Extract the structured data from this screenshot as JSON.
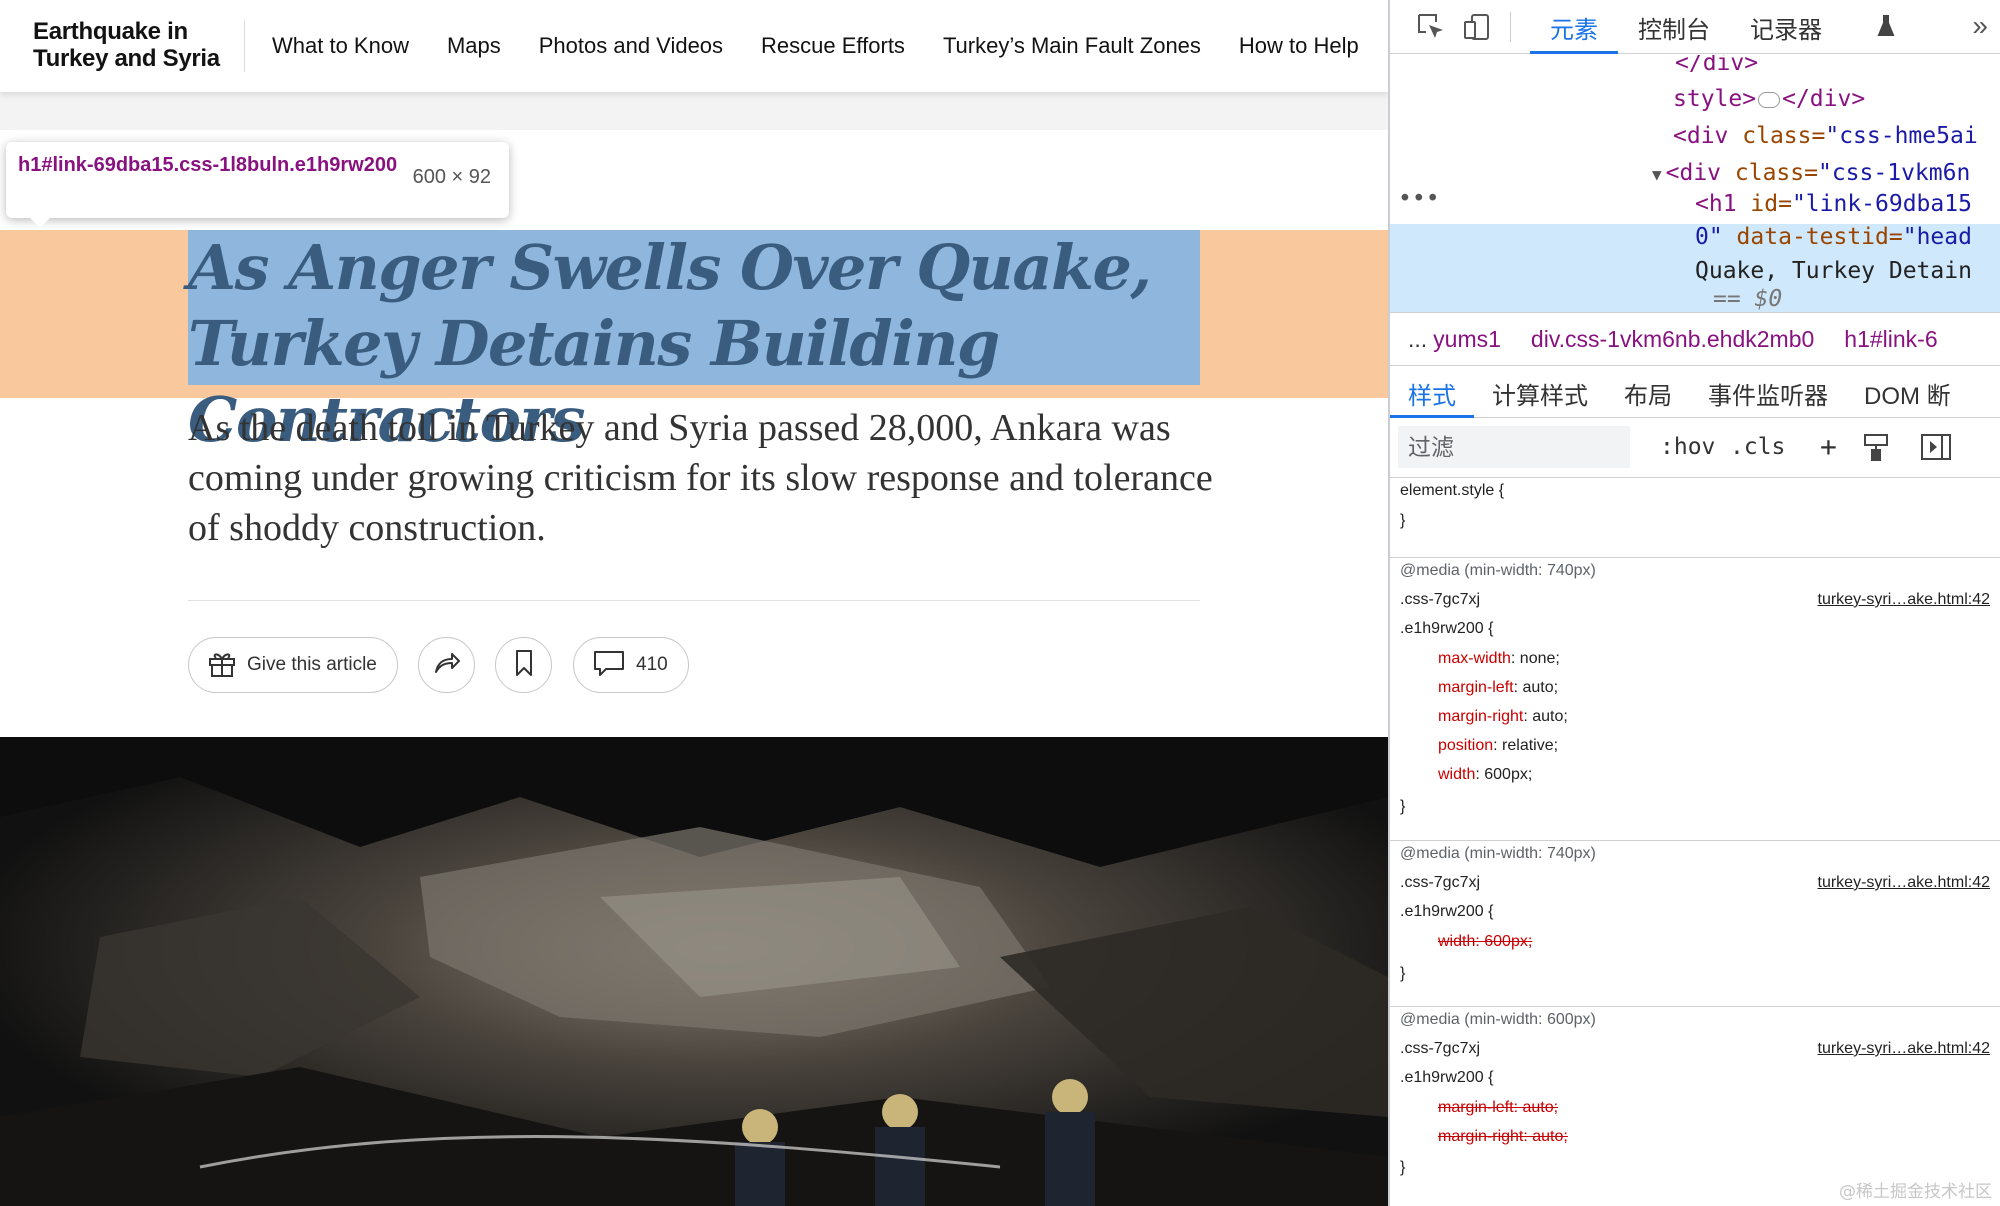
{
  "site": {
    "title_line1": "Earthquake in",
    "title_line2": "Turkey and Syria",
    "nav": [
      "What to Know",
      "Maps",
      "Photos and Videos",
      "Rescue Efforts",
      "Turkey’s Main Fault Zones",
      "How to Help"
    ]
  },
  "inspector_tooltip": {
    "selector": "h1#link-69dba15.css-1l8buln.e1h9rw200",
    "size": "600 × 92"
  },
  "article": {
    "headline": "As Anger Swells Over Quake, Turkey Detains Building Contractors",
    "summary": "As the death toll in Turkey and Syria passed 28,000, Ankara was coming under growing criticism for its slow response and tolerance of shoddy construction.",
    "gift_label": "Give this article",
    "comment_count": "410"
  },
  "devtools": {
    "tabs": [
      "元素",
      "控制台",
      "记录器"
    ],
    "dom": {
      "line0": "style>",
      "line0_end": "</div>",
      "line1_tag": "<div ",
      "line1_attr": "class=",
      "line1_val": "\"css-hme5ai",
      "line2_tag": "<div ",
      "line2_attr": "class=",
      "line2_val": "\"css-1vkm6n",
      "line3_tag": "<h1 ",
      "line3_attr": "id=",
      "line3_val": "\"link-69dba15",
      "line4_val": "0\"",
      "line4_attr": " data-testid=",
      "line4_val2": "\"head",
      "line5": "Quake, Turkey Detain",
      "line6": "== $0"
    },
    "breadcrumb": [
      "...",
      "yums1",
      "div.css-1vkm6nb.ehdk2mb0",
      "h1#link-6"
    ],
    "style_tabs": [
      "样式",
      "计算样式",
      "布局",
      "事件监听器",
      "DOM 断"
    ],
    "filter_placeholder": "过滤",
    "filter_buttons": [
      ":hov",
      ".cls"
    ],
    "rules": {
      "element_style": "element.style {",
      "close": "}",
      "media1": "@media (min-width: 740px)",
      "sel1a": ".css-7gc7xj",
      "sel1b": ".e1h9rw200 {",
      "src1": "turkey-syri…ake.html:42",
      "p1": "max-width",
      "v1": ": none;",
      "p2": "margin-left",
      "v2": ": auto;",
      "p3": "margin-right",
      "v3": ": auto;",
      "p4": "position",
      "v4": ": relative;",
      "p5": "width",
      "v5": ": 600px;",
      "media2": "@media (min-width: 740px)",
      "sel2a": ".css-7gc7xj",
      "sel2b": ".e1h9rw200 {",
      "src2": "turkey-syri…ake.html:42",
      "struck1": "width: 600px;",
      "media3": "@media (min-width: 600px)",
      "sel3a": ".css-7gc7xj",
      "sel3b": ".e1h9rw200 {",
      "src3": "turkey-syri…ake.html:42",
      "struck2": "margin-left: auto;",
      "struck3": "margin-right: auto;"
    },
    "watermark": "@稀土掘金技术社区"
  },
  "colors": {
    "highlight_margin": "#f9c89c",
    "highlight_content": "#8fb6dc",
    "accent": "#1a73e8",
    "tag": "#881280"
  }
}
